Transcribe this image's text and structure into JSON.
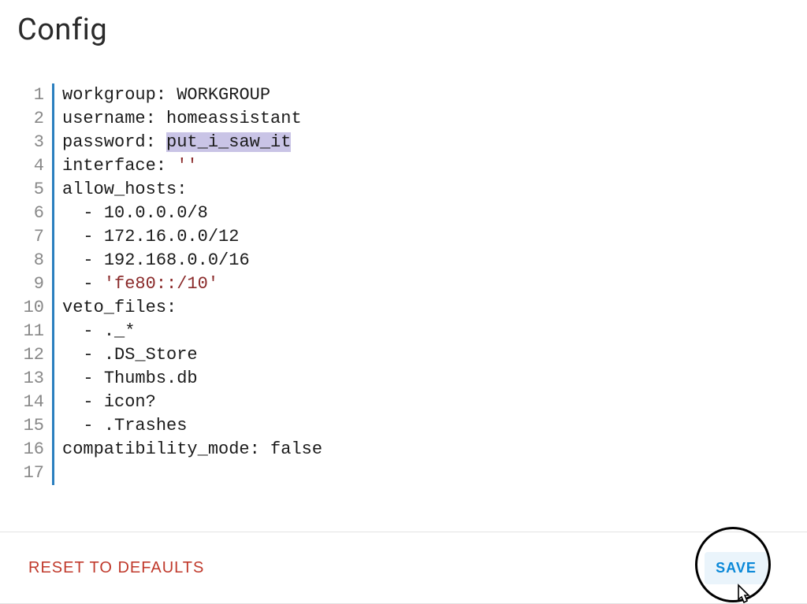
{
  "title": "Config",
  "editor": {
    "lines": [
      {
        "n": 1,
        "kind": "kv",
        "key": "workgroup",
        "val": "WORKGROUP"
      },
      {
        "n": 2,
        "kind": "kv",
        "key": "username",
        "val": "homeassistant"
      },
      {
        "n": 3,
        "kind": "kv",
        "key": "password",
        "val": "put_i_saw_it",
        "selected": true
      },
      {
        "n": 4,
        "kind": "kv",
        "key": "interface",
        "val": "''",
        "valstyle": "str"
      },
      {
        "n": 5,
        "kind": "key",
        "key": "allow_hosts"
      },
      {
        "n": 6,
        "kind": "item",
        "val": "10.0.0.0/8"
      },
      {
        "n": 7,
        "kind": "item",
        "val": "172.16.0.0/12"
      },
      {
        "n": 8,
        "kind": "item",
        "val": "192.168.0.0/16"
      },
      {
        "n": 9,
        "kind": "item",
        "val": "'fe80::/10'",
        "valstyle": "str"
      },
      {
        "n": 10,
        "kind": "key",
        "key": "veto_files"
      },
      {
        "n": 11,
        "kind": "item",
        "val": "._*"
      },
      {
        "n": 12,
        "kind": "item",
        "val": ".DS_Store"
      },
      {
        "n": 13,
        "kind": "item",
        "val": "Thumbs.db"
      },
      {
        "n": 14,
        "kind": "item",
        "val": "icon?"
      },
      {
        "n": 15,
        "kind": "item",
        "val": ".Trashes"
      },
      {
        "n": 16,
        "kind": "kv",
        "key": "compatibility_mode",
        "val": "false"
      },
      {
        "n": 17,
        "kind": "blank"
      }
    ]
  },
  "footer": {
    "reset_label": "RESET TO DEFAULTS",
    "save_label": "SAVE"
  }
}
